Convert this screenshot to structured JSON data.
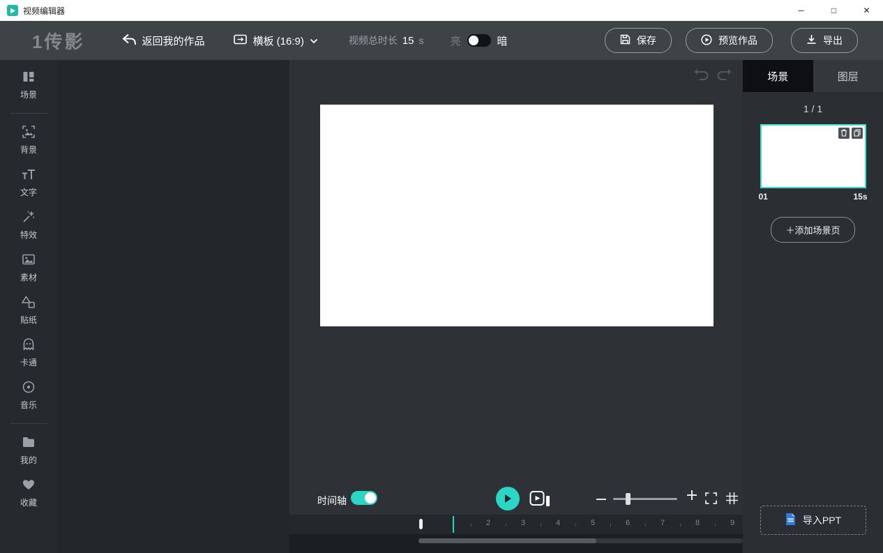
{
  "colors": {
    "accent": "#2cd6c4",
    "thumb_border": "#3ce0cd",
    "ppt_icon_blue": "#2e7ce4"
  },
  "titlebar": {
    "app_title": "视频编辑器",
    "minimize_glyph": "─",
    "maximize_glyph": "□",
    "close_glyph": "✕"
  },
  "toolbar": {
    "logo": "1传影",
    "back_label": "返回我的作品",
    "aspect_label": "横板 (16:9)",
    "duration_label": "视频总时长",
    "duration_value": "15",
    "duration_unit": "s",
    "theme_light_label": "亮",
    "theme_dark_label": "暗",
    "save_label": "保存",
    "preview_label": "预览作品",
    "export_label": "导出"
  },
  "sidebar": {
    "items": [
      {
        "label": "场景",
        "icon": "scenes-icon"
      },
      {
        "label": "背景",
        "icon": "background-icon"
      },
      {
        "label": "文字",
        "icon": "text-icon"
      },
      {
        "label": "特效",
        "icon": "effects-icon"
      },
      {
        "label": "素材",
        "icon": "assets-icon"
      },
      {
        "label": "贴纸",
        "icon": "sticker-icon"
      },
      {
        "label": "卡通",
        "icon": "cartoon-icon"
      },
      {
        "label": "音乐",
        "icon": "music-icon"
      },
      {
        "label": "我的",
        "icon": "folder-icon"
      },
      {
        "label": "收藏",
        "icon": "heart-icon"
      }
    ]
  },
  "right_panel": {
    "tab_scene": "场景",
    "tab_layer": "图层",
    "page_indicator": "1 / 1",
    "scene_index": "01",
    "scene_duration": "15s",
    "add_scene_label": "＋添加场景页",
    "import_ppt_label": "导入PPT"
  },
  "timeline": {
    "toggle_label": "时间轴",
    "ruler_ticks": [
      "2",
      "3",
      "4",
      "5",
      "6",
      "7",
      "8",
      "9"
    ]
  }
}
